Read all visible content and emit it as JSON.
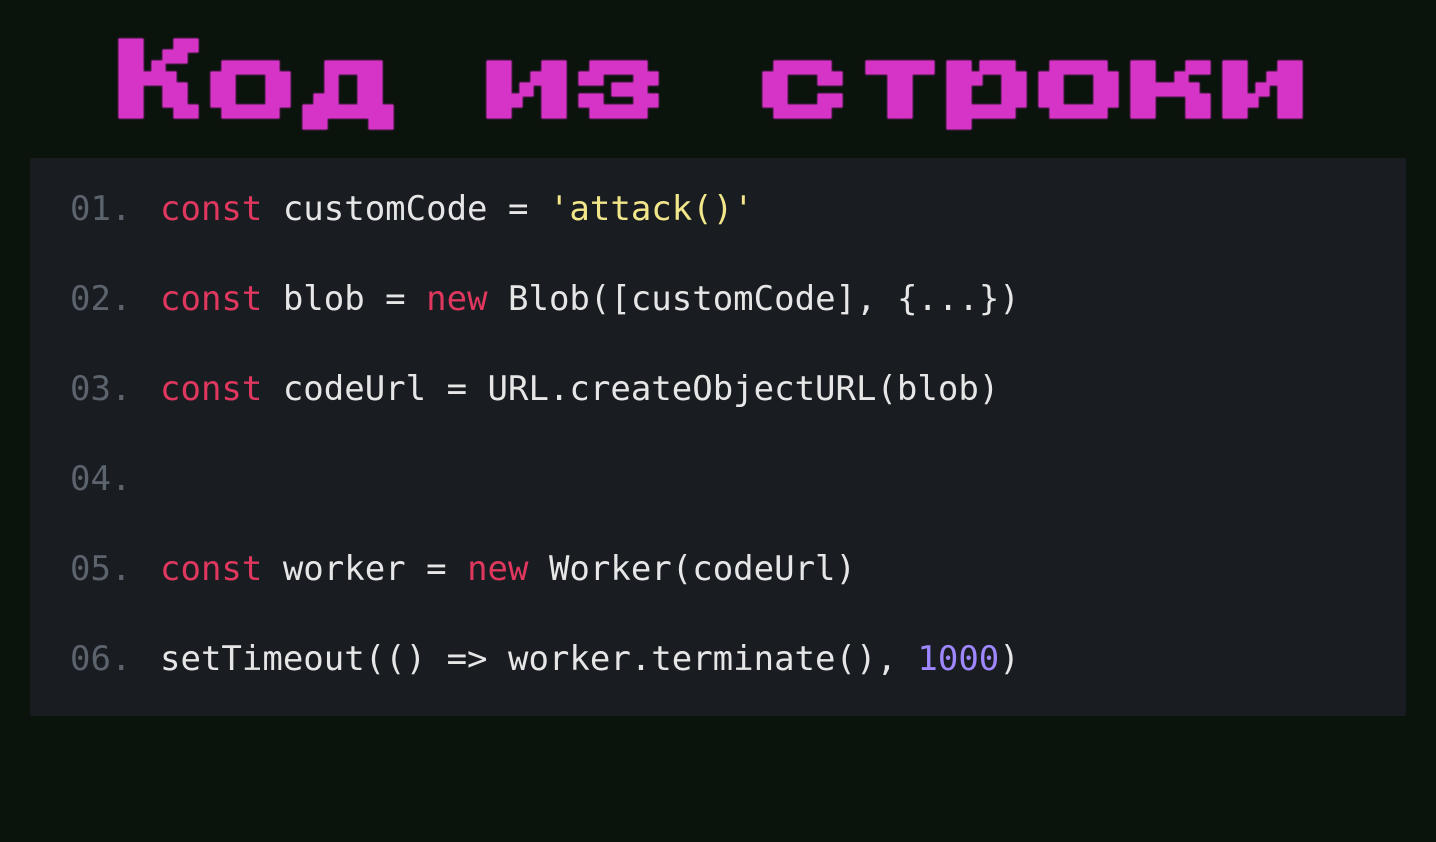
{
  "title": "Код из строки",
  "colors": {
    "background": "#0a130c",
    "code_background": "#191d22",
    "title": "#d633c7",
    "line_number": "#5c636d",
    "keyword": "#e0375f",
    "string": "#f2e68a",
    "number": "#9f87ff",
    "plain": "#e6e6e6"
  },
  "code": {
    "lines": [
      {
        "num": "01.",
        "tokens": [
          {
            "cls": "kw",
            "text": "const"
          },
          {
            "cls": "pln",
            "text": " customCode = "
          },
          {
            "cls": "str",
            "text": "'attack()'"
          }
        ]
      },
      {
        "num": "02.",
        "tokens": [
          {
            "cls": "kw",
            "text": "const"
          },
          {
            "cls": "pln",
            "text": " blob = "
          },
          {
            "cls": "kw",
            "text": "new"
          },
          {
            "cls": "pln",
            "text": " Blob([customCode], {...})"
          }
        ]
      },
      {
        "num": "03.",
        "tokens": [
          {
            "cls": "kw",
            "text": "const"
          },
          {
            "cls": "pln",
            "text": " codeUrl = URL.createObjectURL(blob)"
          }
        ]
      },
      {
        "num": "04.",
        "tokens": [
          {
            "cls": "pln",
            "text": ""
          }
        ]
      },
      {
        "num": "05.",
        "tokens": [
          {
            "cls": "kw",
            "text": "const"
          },
          {
            "cls": "pln",
            "text": " worker = "
          },
          {
            "cls": "kw",
            "text": "new"
          },
          {
            "cls": "pln",
            "text": " Worker(codeUrl)"
          }
        ]
      },
      {
        "num": "06.",
        "tokens": [
          {
            "cls": "pln",
            "text": "setTimeout(() => worker.terminate(), "
          },
          {
            "cls": "num",
            "text": "1000"
          },
          {
            "cls": "pln",
            "text": ")"
          }
        ]
      }
    ]
  }
}
